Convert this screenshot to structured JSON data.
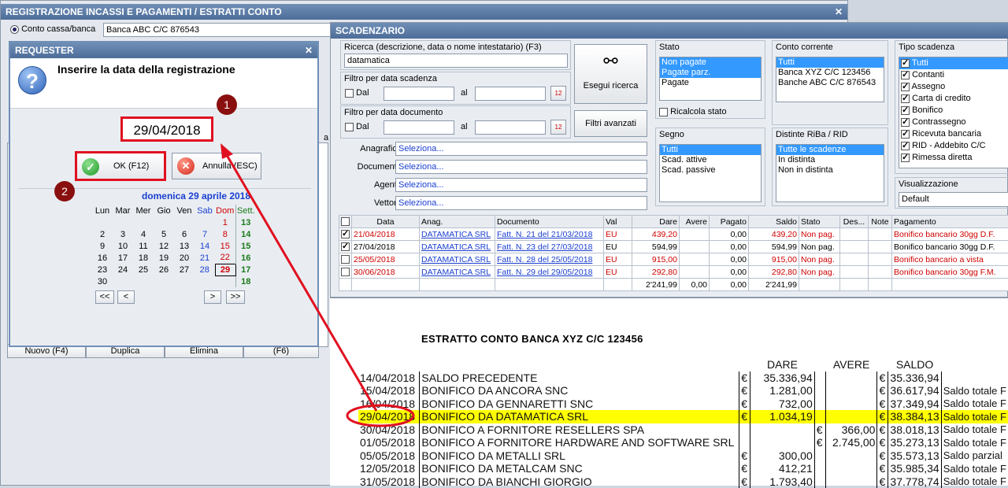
{
  "reg_window": {
    "title": "REGISTRAZIONE INCASSI E PAGAMENTI / ESTRATTI CONTO",
    "close": "✕",
    "radio_label": "Conto cassa/banca",
    "account": "Banca ABC C/C 876543",
    "partial_label": "a c",
    "footer_buttons": [
      "Nuovo (F4)",
      "Duplica",
      "Elimina",
      "(F6)"
    ]
  },
  "requester": {
    "title": "REQUESTER",
    "close": "✕",
    "prompt": "Inserire la data della registrazione",
    "date_value": "29/04/2018",
    "ok_label": "OK (F12)",
    "cancel_label": "Annulla (ESC)",
    "marker1": "1",
    "marker2": "2",
    "calendar": {
      "header": "domenica 29 aprile 2018",
      "days": [
        "Lun",
        "Mar",
        "Mer",
        "Gio",
        "Ven",
        "Sab",
        "Dom"
      ],
      "week_label": "Sett.",
      "weeks": [
        [
          "",
          "",
          "",
          "",
          "",
          "",
          "1",
          "13"
        ],
        [
          "2",
          "3",
          "4",
          "5",
          "6",
          "7",
          "8",
          "14"
        ],
        [
          "9",
          "10",
          "11",
          "12",
          "13",
          "14",
          "15",
          "15"
        ],
        [
          "16",
          "17",
          "18",
          "19",
          "20",
          "21",
          "22",
          "16"
        ],
        [
          "23",
          "24",
          "25",
          "26",
          "27",
          "28",
          "29",
          "17"
        ],
        [
          "30",
          "",
          "",
          "",
          "",
          "",
          "",
          "18"
        ]
      ],
      "nav": [
        "<<",
        "<",
        ">",
        ">>"
      ]
    }
  },
  "scad": {
    "title": "SCADENZARIO",
    "search_label": "Ricerca (descrizione, data o nome intestatario) (F3)",
    "search_value": "datamatica",
    "search_button": "Esegui ricerca",
    "advanced_button": "Filtri avanzati",
    "filter_due_label": "Filtro per data scadenza",
    "filter_doc_label": "Filtro per data documento",
    "dal": "Dal",
    "al": "al",
    "rows": [
      {
        "label": "Anagrafica :",
        "value": "Seleziona..."
      },
      {
        "label": "Documento :",
        "value": "Seleziona..."
      },
      {
        "label": "Agente :",
        "value": "Seleziona..."
      },
      {
        "label": "Vettore :",
        "value": "Seleziona..."
      }
    ],
    "stato": {
      "title": "Stato",
      "items": [
        "Non pagate",
        "Pagate parz.",
        "Pagate"
      ],
      "recalc": "Ricalcola stato"
    },
    "conto": {
      "title": "Conto corrente",
      "items": [
        "Tutti",
        "Banca XYZ C/C 123456",
        "Banche ABC C/C 876543"
      ]
    },
    "tipo": {
      "title": "Tipo scadenza",
      "items": [
        "Tutti",
        "Contanti",
        "Assegno",
        "Carta di credito",
        "Bonifico",
        "Contrassegno",
        "Ricevuta bancaria",
        "RID - Addebito C/C",
        "Rimessa diretta"
      ]
    },
    "segno": {
      "title": "Segno",
      "items": [
        "Tutti",
        "Scad. attive",
        "Scad. passive"
      ]
    },
    "distinte": {
      "title": "Distinte RiBa / RID",
      "items": [
        "Tutte le scadenze",
        "In distinta",
        "Non in distinta"
      ]
    },
    "vis": {
      "title": "Visualizzazione",
      "value": "Default"
    },
    "columns": [
      "Data",
      "Anag.",
      "Documento",
      "Val",
      "Dare",
      "Avere",
      "Pagato",
      "Saldo",
      "Stato",
      "Des...",
      "Note",
      "Pagamento"
    ],
    "grid": [
      {
        "checked": true,
        "data": "21/04/2018",
        "anag": "DATAMATICA SRL",
        "doc": "Fatt. N. 21 del 21/03/2018",
        "val": "EU",
        "dare": "439,20",
        "avere": "",
        "pagato": "0,00",
        "saldo": "439,20",
        "stato": "Non pag.",
        "pag": "Bonifico bancario 30gg D.F.",
        "red": true
      },
      {
        "checked": true,
        "data": "27/04/2018",
        "anag": "DATAMATICA SRL",
        "doc": "Fatt. N. 23 del 27/03/2018",
        "val": "EU",
        "dare": "594,99",
        "avere": "",
        "pagato": "0,00",
        "saldo": "594,99",
        "stato": "Non pag.",
        "pag": "Bonifico bancario 30gg D.F.",
        "red": false
      },
      {
        "checked": false,
        "data": "25/05/2018",
        "anag": "DATAMATICA SRL",
        "doc": "Fatt. N. 28 del 25/05/2018",
        "val": "EU",
        "dare": "915,00",
        "avere": "",
        "pagato": "0,00",
        "saldo": "915,00",
        "stato": "Non pag.",
        "pag": "Bonifico bancario a vista",
        "red": true
      },
      {
        "checked": false,
        "data": "30/06/2018",
        "anag": "DATAMATICA SRL",
        "doc": "Fatt. N. 29 del 29/05/2018",
        "val": "EU",
        "dare": "292,80",
        "avere": "",
        "pagato": "0,00",
        "saldo": "292,80",
        "stato": "Non pag.",
        "pag": "Bonifico bancario 30gg F.M.",
        "red": true
      }
    ],
    "totals": {
      "dare": "2'241,99",
      "avere": "0,00",
      "pagato": "0,00",
      "saldo": "2'241,99"
    }
  },
  "estratto": {
    "title": "ESTRATTO CONTO BANCA XYZ C/C 123456",
    "h_dare": "DARE",
    "h_avere": "AVERE",
    "h_saldo": "SALDO",
    "rows": [
      {
        "date": "14/04/2018",
        "desc": "SALDO PRECEDENTE",
        "cd": "€",
        "dare": "35.336,94",
        "ca": "",
        "avere": "",
        "cs": "€",
        "saldo": "35.336,94",
        "note": ""
      },
      {
        "date": "15/04/2018",
        "desc": "BONIFICO DA ANCORA SNC",
        "cd": "€",
        "dare": "1.281,00",
        "ca": "",
        "avere": "",
        "cs": "€",
        "saldo": "36.617,94",
        "note": "Saldo totale F"
      },
      {
        "date": "16/04/2018",
        "desc": "BONIFICO DA GENNARETTI SNC",
        "cd": "€",
        "dare": "732,00",
        "ca": "",
        "avere": "",
        "cs": "€",
        "saldo": "37.349,94",
        "note": "Saldo totale F"
      },
      {
        "date": "29/04/2018",
        "desc": "BONIFICO DA DATAMATICA SRL",
        "cd": "€",
        "dare": "1.034,19",
        "ca": "",
        "avere": "",
        "cs": "€",
        "saldo": "38.384,13",
        "note": "Saldo totale F",
        "hl": true
      },
      {
        "date": "30/04/2018",
        "desc": "BONIFICO A FORNITORE RESELLERS SPA",
        "cd": "",
        "dare": "",
        "ca": "€",
        "avere": "366,00",
        "cs": "€",
        "saldo": "38.018,13",
        "note": "Saldo totale F"
      },
      {
        "date": "01/05/2018",
        "desc": "BONIFICO A FORNITORE HARDWARE AND SOFTWARE SRL",
        "cd": "",
        "dare": "",
        "ca": "€",
        "avere": "2.745,00",
        "cs": "€",
        "saldo": "35.273,13",
        "note": "Saldo totale F"
      },
      {
        "date": "05/05/2018",
        "desc": "BONIFICO DA METALLI SRL",
        "cd": "€",
        "dare": "300,00",
        "ca": "",
        "avere": "",
        "cs": "€",
        "saldo": "35.573,13",
        "note": "Saldo parzial"
      },
      {
        "date": "12/05/2018",
        "desc": "BONIFICO DA METALCAM SNC",
        "cd": "€",
        "dare": "412,21",
        "ca": "",
        "avere": "",
        "cs": "€",
        "saldo": "35.985,34",
        "note": "Saldo totale F"
      },
      {
        "date": "31/05/2018",
        "desc": "BONIFICO DA BIANCHI GIORGIO",
        "cd": "€",
        "dare": "1.793,40",
        "ca": "",
        "avere": "",
        "cs": "€",
        "saldo": "37.778,74",
        "note": "Saldo totale F"
      }
    ]
  },
  "colors": {
    "accent": "#e01020",
    "highlight": "#ffff00",
    "link": "#1a3fd0"
  }
}
